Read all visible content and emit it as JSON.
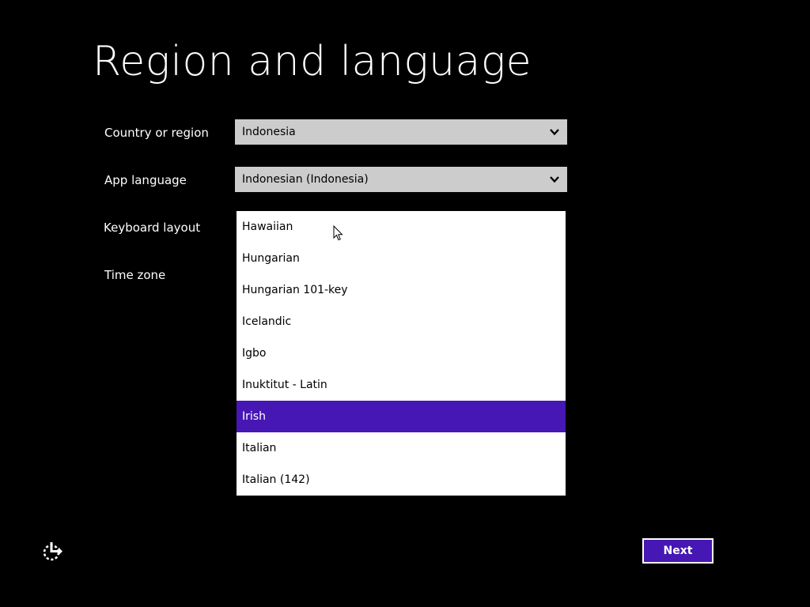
{
  "title": "Region and language",
  "colors": {
    "background": "#000000",
    "select_bg": "#cccccc",
    "accent": "#4617b4"
  },
  "fields": {
    "country_label": "Country or region",
    "country_value": "Indonesia",
    "app_language_label": "App language",
    "app_language_value": "Indonesian (Indonesia)",
    "keyboard_label": "Keyboard layout",
    "time_zone_label": "Time zone"
  },
  "keyboard_dropdown": {
    "options": [
      "Hawaiian",
      "Hungarian",
      "Hungarian 101-key",
      "Icelandic",
      "Igbo",
      "Inuktitut - Latin",
      "Irish",
      "Italian",
      "Italian (142)"
    ],
    "selected": "Irish"
  },
  "footer": {
    "ease_of_access_icon": "ease-of-access-icon",
    "next_label": "Next"
  }
}
